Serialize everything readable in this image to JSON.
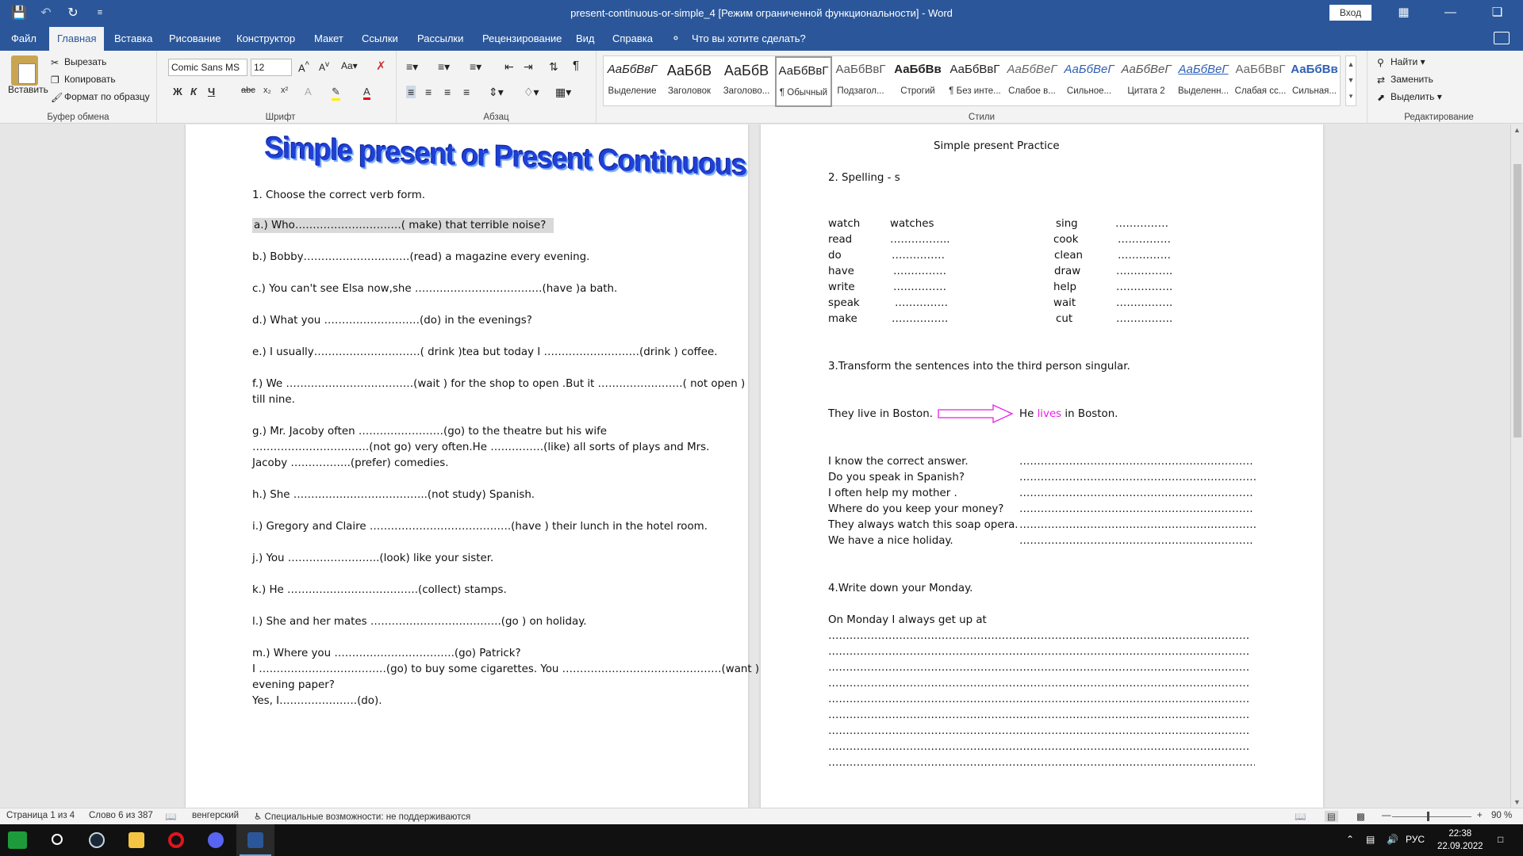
{
  "titlebar": {
    "title": "present-continuous-or-simple_4 [Режим ограниченной функциональности]  -  Word",
    "login": "Вход"
  },
  "tabs": [
    "Файл",
    "Главная",
    "Вставка",
    "Рисование",
    "Конструктор",
    "Макет",
    "Ссылки",
    "Рассылки",
    "Рецензирование",
    "Вид",
    "Справка"
  ],
  "tell_me": "Что вы хотите сделать?",
  "ribbon": {
    "clipboard": {
      "paste": "Вставить",
      "cut": "Вырезать",
      "copy": "Копировать",
      "format_painter": "Формат по образцу",
      "label": "Буфер обмена"
    },
    "font": {
      "name": "Comic Sans MS",
      "size": "12",
      "label": "Шрифт",
      "bold": "Ж",
      "italic": "К",
      "underline": "Ч",
      "strike": "abc",
      "sub": "x₂",
      "sup": "x²"
    },
    "paragraph": {
      "label": "Абзац"
    },
    "styles": {
      "label": "Стили",
      "items": [
        {
          "sample": "АаБбВвГ",
          "name": "Выделение"
        },
        {
          "sample": "АаБбВ",
          "name": "Заголовок"
        },
        {
          "sample": "АаБбВ",
          "name": "Заголово..."
        },
        {
          "sample": "АаБбВвГ",
          "name": "¶ Обычный"
        },
        {
          "sample": "АаБбВвГ",
          "name": "Подзагол..."
        },
        {
          "sample": "АаБбВв",
          "name": "Строгий"
        },
        {
          "sample": "АаБбВвГ",
          "name": "¶ Без инте..."
        },
        {
          "sample": "АаБбВеГ",
          "name": "Слабое в..."
        },
        {
          "sample": "АаБбВеГ",
          "name": "Сильное..."
        },
        {
          "sample": "АаБбВеГ",
          "name": "Цитата 2"
        },
        {
          "sample": "АаБбВеГ",
          "name": "Выделенн..."
        },
        {
          "sample": "АаБбВвГ",
          "name": "Слабая сс..."
        },
        {
          "sample": "АаБбВв",
          "name": "Сильная..."
        }
      ]
    },
    "editing": {
      "label": "Редактирование",
      "find": "Найти",
      "replace": "Заменить",
      "select": "Выделить"
    }
  },
  "page1": {
    "wordart": "Simple present or Present Continuous",
    "task1": "1. Choose the correct verb form.",
    "lines": [
      "a.) Who…………………………( make) that terrible  noise?",
      "b.) Bobby…………………………(read) a magazine every evening.",
      "c.) You can't see Elsa now,she ………………………………(have )a bath.",
      "d.) What       you ………………………(do) in the evenings?",
      "e.) I usually…………………………( drink )tea but today I ………………………(drink ) coffee.",
      "f.) We ………………………………(wait ) for the shop to open .But it  ……………………( not open )",
      "till nine.",
      "g.) Mr. Jacoby often ……………………(go) to the theatre but his wife",
      "……………………………(not go) very often.He ……………(like) all sorts of plays and Mrs.",
      "Jacoby  ……………..(prefer) comedies.",
      "h.) She ………………………………..(not study) Spanish.",
      "i.) Gregory and Claire ………………………………….(have ) their lunch in the hotel room.",
      "j.) You ……………………..(look) like your sister.",
      "k.) He ……………………………….(collect) stamps.",
      "l.) She and  her mates ……………………………….(go ) on holiday.",
      "m.)  Where  you      …………………………….(go) Patrick?",
      "I ………………………………(go) to buy some cigarettes.  You ………………………………………(want ) an",
      "evening paper?",
      "Yes, I………………….(do)."
    ]
  },
  "page2": {
    "header": "Simple present Practice",
    "task2": "2.  Spelling        -  s",
    "spell_left": [
      {
        "w": "watch",
        "a": "watches"
      },
      {
        "w": "read",
        "a": "…………….."
      },
      {
        "w": "do",
        "a": "……………"
      },
      {
        "w": "have",
        "a": "……………"
      },
      {
        "w": "write",
        "a": "……………"
      },
      {
        "w": "speak",
        "a": "……………"
      },
      {
        "w": "make",
        "a": "……………."
      }
    ],
    "spell_right": [
      {
        "w": "sing",
        "a": "……………"
      },
      {
        "w": "cook",
        "a": "……………"
      },
      {
        "w": "clean",
        "a": "……………"
      },
      {
        "w": "draw",
        "a": "……………."
      },
      {
        "w": "help",
        "a": "……………."
      },
      {
        "w": "wait",
        "a": "……………."
      },
      {
        "w": "cut",
        "a": "……………."
      }
    ],
    "task3": "3.Transform the sentences into the third person singular.",
    "example_left": "They live in Boston.",
    "example_he": "He ",
    "example_lives": "lives",
    "example_rest": " in Boston.",
    "sentences": [
      "I know the correct answer.",
      "Do you speak in Spanish?",
      "I often help my mother .",
      "Where do you keep your money?",
      "They always watch this soap opera.",
      "We have a nice holiday."
    ],
    "answer_line": "…………………………………………………………………………………………………………",
    "task4": "4.Write down your Monday.",
    "monday": "On Monday I always  get up at",
    "write_line": "……………………………………………………………………………………………………………………………"
  },
  "statusbar": {
    "page": "Страница 1 из 4",
    "words": "Слово 6 из 387",
    "language": "венгерский",
    "accessibility": "Специальные возможности: не поддерживаются",
    "zoom": "90 %"
  },
  "taskbar": {
    "lang": "РУС",
    "time": "22:38",
    "date": "22.09.2022"
  },
  "colors": {
    "word_blue": "#2b579a",
    "wordart_blue": "#1f3fd6",
    "pink": "#e81ee8"
  }
}
